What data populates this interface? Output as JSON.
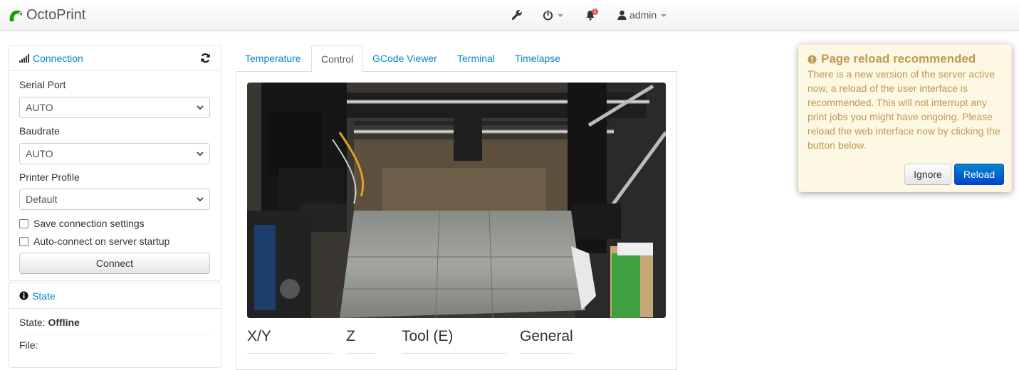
{
  "navbar": {
    "brand": "OctoPrint",
    "settings_icon": "wrench-icon",
    "power_icon": "power-icon",
    "notifications_icon": "bell-icon",
    "notification_count": "1",
    "user_label": "admin"
  },
  "connection": {
    "title": "Connection",
    "serial_port_label": "Serial Port",
    "serial_port_value": "AUTO",
    "baudrate_label": "Baudrate",
    "baudrate_value": "AUTO",
    "printer_profile_label": "Printer Profile",
    "printer_profile_value": "Default",
    "save_settings_label": "Save connection settings",
    "save_settings_checked": false,
    "auto_connect_label": "Auto-connect on server startup",
    "auto_connect_checked": false,
    "connect_button": "Connect"
  },
  "state": {
    "title": "State",
    "state_label": "State:",
    "state_value": "Offline",
    "file_label": "File:"
  },
  "tabs": [
    {
      "label": "Temperature",
      "active": false
    },
    {
      "label": "Control",
      "active": true
    },
    {
      "label": "GCode Viewer",
      "active": false
    },
    {
      "label": "Terminal",
      "active": false
    },
    {
      "label": "Timelapse",
      "active": false
    }
  ],
  "control": {
    "sections": [
      "X/Y",
      "Z",
      "Tool (E)",
      "General"
    ]
  },
  "notification": {
    "title": "Page reload recommended",
    "message": "There is a new version of the server active now, a reload of the user interface is recommended. This will not interrupt any print jobs you might have ongoing. Please reload the web interface now by clicking the button below.",
    "ignore_button": "Ignore",
    "reload_button": "Reload"
  },
  "colors": {
    "link": "#0088cc",
    "warning_bg": "#fcf8e3",
    "warning_text": "#c09853",
    "primary": "#0055cc",
    "brand_green": "#17a100"
  }
}
